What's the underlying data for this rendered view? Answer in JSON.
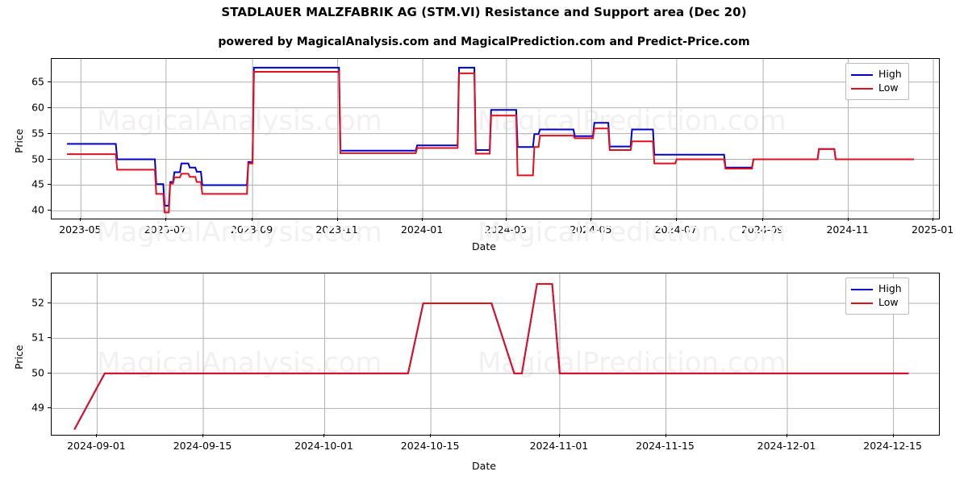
{
  "header": {
    "title": "STADLAUER MALZFABRIK AG (STM.VI) Resistance and Support area (Dec 20)",
    "subtitle": "powered by MagicalAnalysis.com and MagicalPrediction.com and Predict-Price.com"
  },
  "watermarks": [
    "MagicalAnalysis.com",
    "MagicalPrediction.com",
    "MagicalAnalysis.com",
    "MagicalPrediction.com",
    "MagicalAnalysis.com",
    "MagicalPrediction.com"
  ],
  "colors": {
    "high": "#0000cd",
    "low": "#e01020",
    "grid": "#b0b0b0",
    "axis": "#000000",
    "watermark": "#f2f0f0"
  },
  "legend": {
    "high_label": "High",
    "low_label": "Low"
  },
  "chart_data": [
    {
      "id": "top",
      "type": "line",
      "title": "STADLAUER MALZFABRIK AG (STM.VI) Resistance and Support area (Dec 20)",
      "xlabel": "Date",
      "ylabel": "Price",
      "grid": true,
      "legend_position": "top-right",
      "xlim": [
        "2023-04-10",
        "2025-01-05"
      ],
      "ylim": [
        38.5,
        69.5
      ],
      "yticks": [
        40,
        45,
        50,
        55,
        60,
        65
      ],
      "xticks": [
        "2023-05",
        "2023-07",
        "2023-09",
        "2023-11",
        "2024-01",
        "2024-03",
        "2024-05",
        "2024-07",
        "2024-09",
        "2024-11",
        "2025-01"
      ],
      "series": [
        {
          "name": "High",
          "color": "#0000cd",
          "x": [
            "2023-04-21",
            "2023-05-26",
            "2023-05-27",
            "2023-06-23",
            "2023-06-24",
            "2023-06-29",
            "2023-06-30",
            "2023-07-03",
            "2023-07-04",
            "2023-07-06",
            "2023-07-07",
            "2023-07-11",
            "2023-07-12",
            "2023-07-17",
            "2023-07-18",
            "2023-07-22",
            "2023-07-23",
            "2023-07-26",
            "2023-07-27",
            "2023-08-28",
            "2023-08-29",
            "2023-09-01",
            "2023-09-02",
            "2023-11-02",
            "2023-11-03",
            "2023-12-27",
            "2023-12-28",
            "2024-01-26",
            "2024-01-27",
            "2024-02-07",
            "2024-02-08",
            "2024-02-18",
            "2024-02-19",
            "2024-03-08",
            "2024-03-09",
            "2024-03-20",
            "2024-03-21",
            "2024-03-24",
            "2024-03-25",
            "2024-04-18",
            "2024-04-19",
            "2024-05-02",
            "2024-05-03",
            "2024-05-13",
            "2024-05-14",
            "2024-05-29",
            "2024-05-30",
            "2024-06-14",
            "2024-06-15",
            "2024-06-30",
            "2024-07-01",
            "2024-08-04",
            "2024-08-05",
            "2024-08-24",
            "2024-08-25",
            "2024-10-10",
            "2024-10-11",
            "2024-10-22",
            "2024-10-23",
            "2024-10-26",
            "2024-10-27",
            "2024-12-18"
          ],
          "y": [
            53.0,
            53.0,
            50.0,
            50.0,
            45.2,
            45.2,
            41.0,
            41.0,
            45.6,
            45.6,
            47.5,
            47.5,
            49.2,
            49.2,
            48.4,
            48.4,
            47.6,
            47.6,
            45.0,
            45.0,
            49.5,
            49.5,
            67.8,
            67.8,
            51.7,
            51.7,
            52.7,
            52.7,
            67.8,
            67.8,
            51.8,
            51.8,
            59.6,
            59.6,
            52.4,
            52.4,
            54.9,
            54.9,
            55.8,
            55.8,
            54.5,
            54.5,
            57.1,
            57.1,
            52.5,
            52.5,
            55.8,
            55.8,
            50.9,
            50.9,
            50.9,
            50.9,
            48.4,
            48.4,
            50.0,
            50.0,
            52.0,
            52.0,
            50.0,
            50.0,
            50.0,
            50.0
          ]
        },
        {
          "name": "Low",
          "color": "#e01020",
          "x": [
            "2023-04-21",
            "2023-05-26",
            "2023-05-27",
            "2023-06-23",
            "2023-06-24",
            "2023-06-29",
            "2023-06-30",
            "2023-07-03",
            "2023-07-04",
            "2023-07-06",
            "2023-07-07",
            "2023-07-11",
            "2023-07-12",
            "2023-07-17",
            "2023-07-18",
            "2023-07-22",
            "2023-07-23",
            "2023-07-26",
            "2023-07-27",
            "2023-08-28",
            "2023-08-29",
            "2023-09-01",
            "2023-09-02",
            "2023-11-02",
            "2023-11-03",
            "2023-12-27",
            "2023-12-28",
            "2024-01-26",
            "2024-01-27",
            "2024-02-07",
            "2024-02-08",
            "2024-02-18",
            "2024-02-19",
            "2024-03-08",
            "2024-03-09",
            "2024-03-20",
            "2024-03-21",
            "2024-03-24",
            "2024-03-25",
            "2024-04-18",
            "2024-04-19",
            "2024-05-02",
            "2024-05-03",
            "2024-05-13",
            "2024-05-14",
            "2024-05-29",
            "2024-05-30",
            "2024-06-14",
            "2024-06-15",
            "2024-06-30",
            "2024-07-01",
            "2024-08-04",
            "2024-08-05",
            "2024-08-24",
            "2024-08-25",
            "2024-10-10",
            "2024-10-11",
            "2024-10-22",
            "2024-10-23",
            "2024-10-26",
            "2024-10-27",
            "2024-12-18"
          ],
          "y": [
            51.0,
            51.0,
            48.0,
            48.0,
            43.3,
            43.3,
            39.7,
            39.7,
            45.3,
            45.3,
            46.5,
            46.5,
            47.2,
            47.2,
            46.6,
            46.6,
            45.6,
            45.6,
            43.3,
            43.3,
            49.2,
            49.2,
            67.0,
            67.0,
            51.2,
            51.2,
            52.2,
            52.2,
            66.7,
            66.7,
            51.1,
            51.1,
            58.5,
            58.5,
            46.9,
            46.9,
            52.4,
            52.4,
            54.6,
            54.6,
            54.1,
            54.1,
            56.0,
            56.0,
            51.8,
            51.8,
            53.5,
            53.5,
            49.2,
            49.2,
            50.0,
            50.0,
            48.2,
            48.2,
            50.0,
            50.0,
            52.0,
            52.0,
            50.0,
            50.0,
            50.0,
            50.0
          ]
        }
      ]
    },
    {
      "id": "bottom",
      "type": "line",
      "xlabel": "Date",
      "ylabel": "Price",
      "grid": true,
      "legend_position": "top-right",
      "xlim": [
        "2024-08-26",
        "2024-12-21"
      ],
      "ylim": [
        48.25,
        52.85
      ],
      "yticks": [
        49,
        50,
        51,
        52
      ],
      "xticks": [
        "2024-09-01",
        "2024-09-15",
        "2024-10-01",
        "2024-10-15",
        "2024-11-01",
        "2024-11-15",
        "2024-12-01",
        "2024-12-15"
      ],
      "series": [
        {
          "name": "High",
          "color": "#0000cd",
          "x": [
            "2024-08-29",
            "2024-09-02",
            "2024-10-12",
            "2024-10-14",
            "2024-10-23",
            "2024-10-26",
            "2024-10-27",
            "2024-10-29",
            "2024-10-31",
            "2024-11-01",
            "2024-12-17"
          ],
          "y": [
            48.4,
            50.0,
            50.0,
            52.0,
            52.0,
            50.0,
            50.0,
            52.55,
            52.55,
            50.0,
            50.0
          ]
        },
        {
          "name": "Low",
          "color": "#e01020",
          "x": [
            "2024-08-29",
            "2024-09-02",
            "2024-10-12",
            "2024-10-14",
            "2024-10-23",
            "2024-10-26",
            "2024-10-27",
            "2024-10-29",
            "2024-10-31",
            "2024-11-01",
            "2024-12-17"
          ],
          "y": [
            48.4,
            50.0,
            50.0,
            52.0,
            52.0,
            50.0,
            50.0,
            52.55,
            52.55,
            50.0,
            50.0
          ]
        }
      ]
    }
  ]
}
